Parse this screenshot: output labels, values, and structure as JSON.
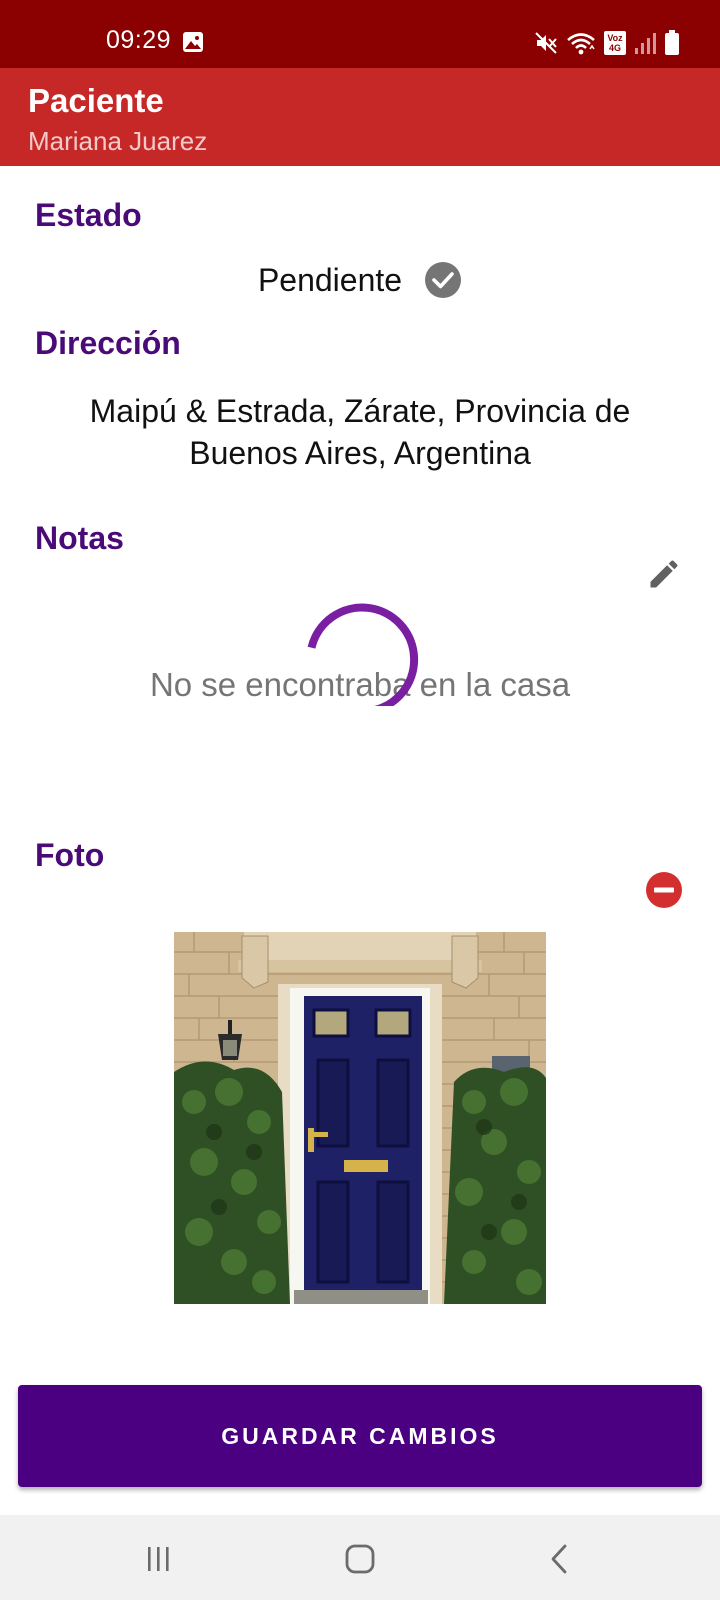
{
  "status_bar": {
    "time": "09:29",
    "network_badge_top": "Voz",
    "network_badge_bottom": "4G"
  },
  "app_bar": {
    "title": "Paciente",
    "subtitle": "Mariana Juarez"
  },
  "estado": {
    "title": "Estado",
    "value": "Pendiente"
  },
  "direccion": {
    "title": "Dirección",
    "value": "Maipú & Estrada, Zárate, Provincia de Buenos Aires, Argentina"
  },
  "notas": {
    "title": "Notas",
    "value": "No se encontraba en la casa"
  },
  "foto": {
    "title": "Foto"
  },
  "actions": {
    "save_label": "GUARDAR CAMBIOS"
  },
  "icons": {
    "status": [
      "gallery-icon",
      "mute-icon",
      "wifi-icon",
      "volte-icon",
      "signal-icon",
      "battery-icon"
    ],
    "estado": "check-circle-icon",
    "notas": "edit-icon",
    "foto": "remove-circle-icon",
    "nav": [
      "recents-icon",
      "home-icon",
      "back-icon"
    ]
  },
  "colors": {
    "status_bar": "#8b0000",
    "app_bar": "#c62828",
    "section_title": "#4a0a78",
    "primary_button": "#4a0080",
    "spinner": "#7b1fa2",
    "remove": "#d32f2f"
  }
}
